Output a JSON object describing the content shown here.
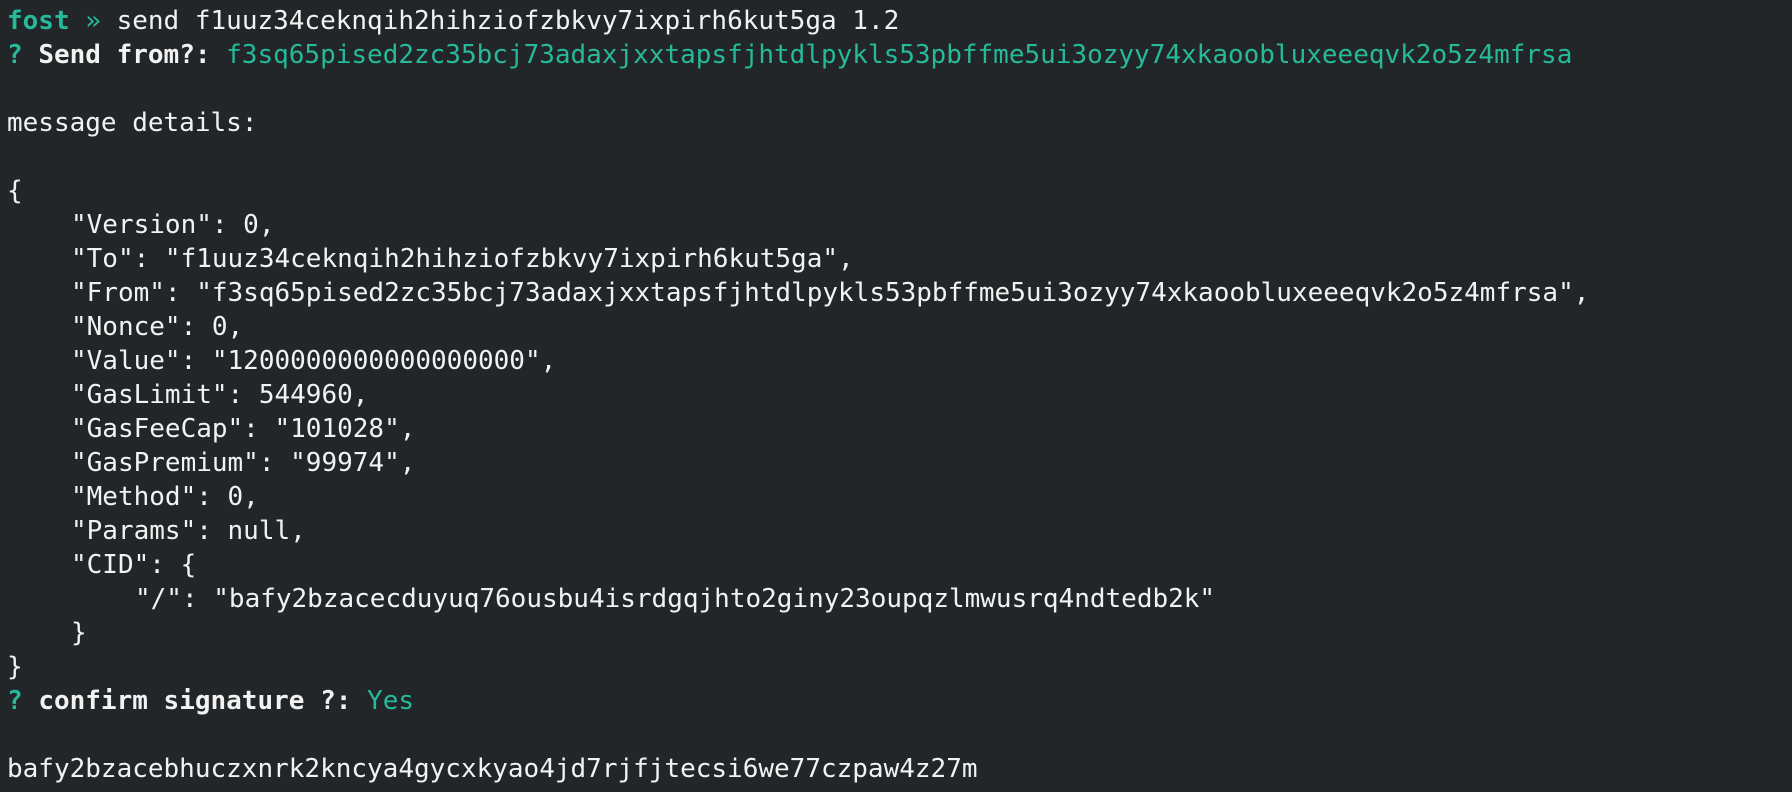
{
  "prompt": {
    "name": "fost",
    "arrow": "»",
    "command": "send f1uuz34ceknqih2hihziofzbkvy7ixpirh6kut5ga 1.2"
  },
  "send_from": {
    "q": "?",
    "label": "Send from?:",
    "value": "f3sq65pised2zc35bcj73adaxjxxtapsfjhtdlpykls53pbffme5ui3ozyy74xkaoobluxeeeqvk2o5z4mfrsa"
  },
  "message_details_label": "message details:",
  "json": {
    "open": "{",
    "lines": [
      "\"Version\": 0,",
      "\"To\": \"f1uuz34ceknqih2hihziofzbkvy7ixpirh6kut5ga\",",
      "\"From\": \"f3sq65pised2zc35bcj73adaxjxxtapsfjhtdlpykls53pbffme5ui3ozyy74xkaoobluxeeeqvk2o5z4mfrsa\",",
      "\"Nonce\": 0,",
      "\"Value\": \"1200000000000000000\",",
      "\"GasLimit\": 544960,",
      "\"GasFeeCap\": \"101028\",",
      "\"GasPremium\": \"99974\",",
      "\"Method\": 0,",
      "\"Params\": null,",
      "\"CID\": {"
    ],
    "cid_inner": "\"/\": \"bafy2bzacecduyuq76ousbu4isrdgqjhto2giny23oupqzlmwusrq4ndtedb2k\"",
    "cid_close": "}",
    "close": "}"
  },
  "confirm": {
    "q": "?",
    "label": "confirm signature ?:",
    "value": "Yes"
  },
  "result_cid": "bafy2bzacebhuczxnrk2kncya4gycxkyao4jd7rjfjtecsi6we77czpaw4z27m",
  "colors": {
    "background": "#222628",
    "text": "#f2f2f2",
    "accent": "#26b99a"
  }
}
